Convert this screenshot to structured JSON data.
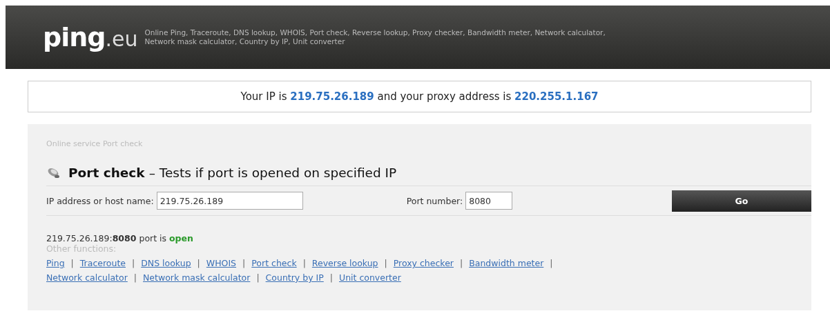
{
  "header": {
    "logo_main": "ping",
    "logo_suffix": ".eu",
    "tagline_lines": [
      "Online Ping, Traceroute, DNS lookup, WHOIS, Port check, Reverse lookup, Proxy checker, Bandwidth meter, Network calculator,",
      "Network mask calculator, Country by IP, Unit converter"
    ]
  },
  "ip_banner": {
    "text": "Your IP is **219.75.26.189** and your proxy address is **220.255.1.167**"
  },
  "breadcrumb": "Online service Port check",
  "heading": {
    "title": "Port check",
    "subtitle": "– Tests if port is opened on specified IP"
  },
  "form": {
    "host_label": "IP address or host name:",
    "host_value": "219.75.26.189",
    "port_label": "Port number:",
    "port_value": "8080",
    "button": "Go"
  },
  "result": {
    "text": "219.75.26.189:**8080** port is",
    "status": "open",
    "open": true
  },
  "other_label": "Other functions:",
  "link_rows": [
    [
      {
        "label": "Ping",
        "separator": "|"
      },
      {
        "label": "Traceroute",
        "separator": "|"
      },
      {
        "label": "DNS lookup",
        "separator": "|"
      },
      {
        "label": "WHOIS",
        "separator": "|"
      },
      {
        "label": "Port check",
        "separator": "|"
      },
      {
        "label": "Reverse lookup",
        "separator": "|"
      },
      {
        "label": "Proxy checker",
        "separator": "|"
      },
      {
        "label": "Bandwidth meter",
        "separator": "|"
      }
    ],
    [
      {
        "label": "Network calculator",
        "separator": "|"
      },
      {
        "label": "Network mask calculator",
        "separator": "|"
      },
      {
        "label": "Country by IP",
        "separator": "|"
      },
      {
        "label": "Unit converter"
      }
    ]
  ]
}
